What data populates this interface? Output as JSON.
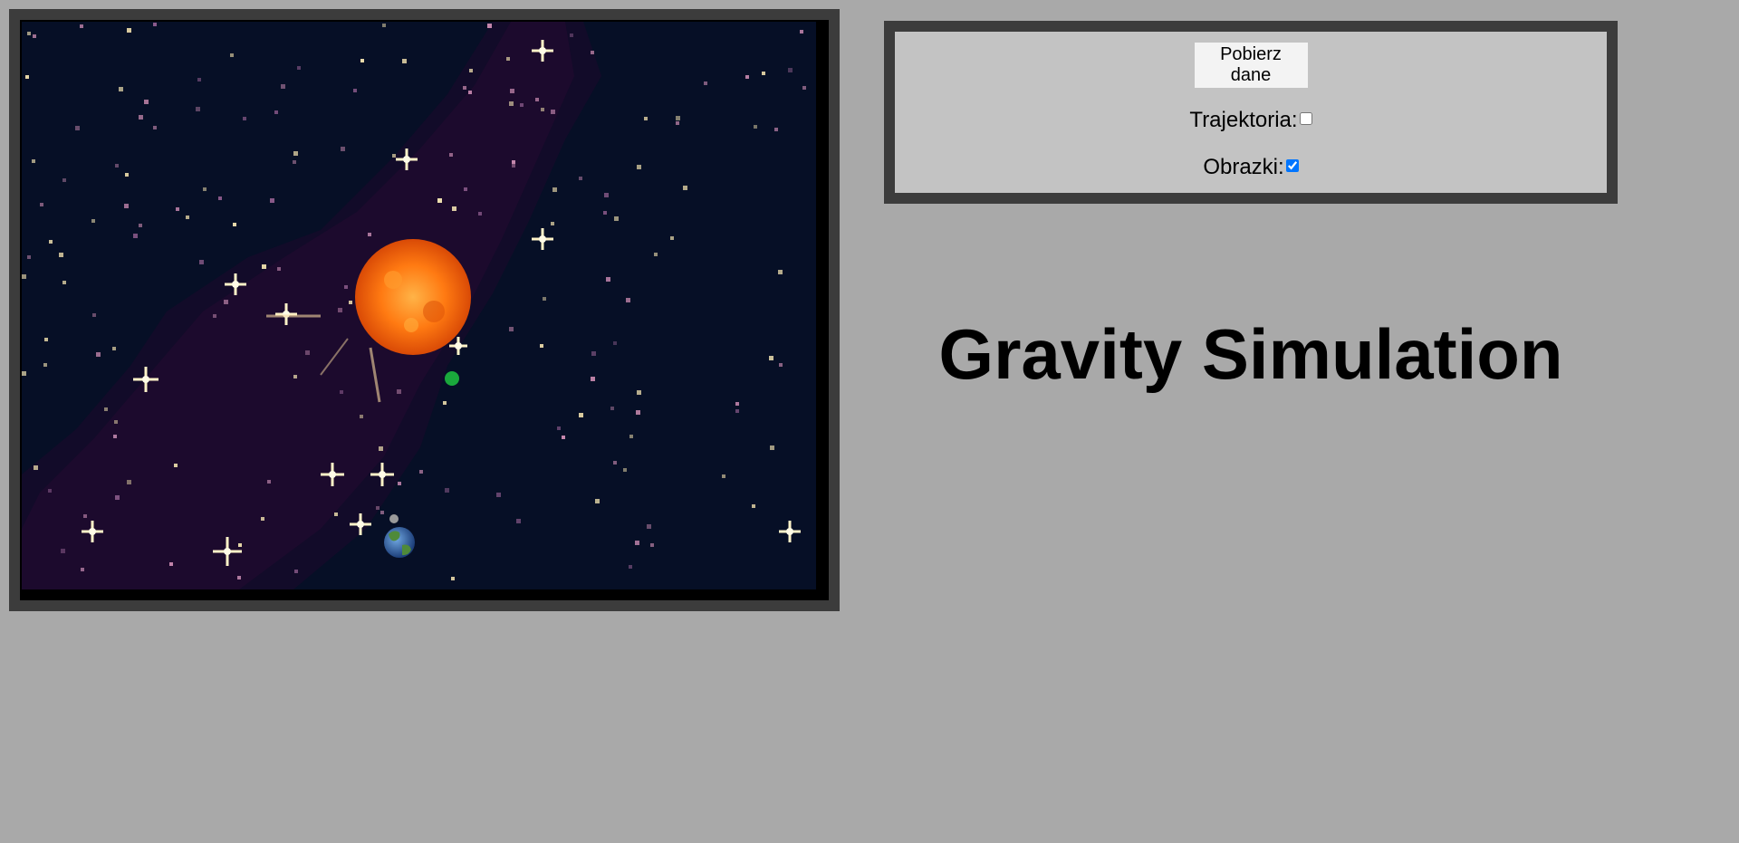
{
  "simulation": {
    "background_color": "#060f26",
    "sun_icon": "sun-sprite",
    "planet_icon": "earth-sprite",
    "moon_icon": "moon-sprite",
    "probe_color": "#1aa83c"
  },
  "controls": {
    "fetch_button_label": "Pobierz dane",
    "trajectory_label": "Trajektoria:",
    "trajectory_checked": false,
    "images_label": "Obrazki:",
    "images_checked": true
  },
  "heading": {
    "title": "Gravity Simulation"
  }
}
